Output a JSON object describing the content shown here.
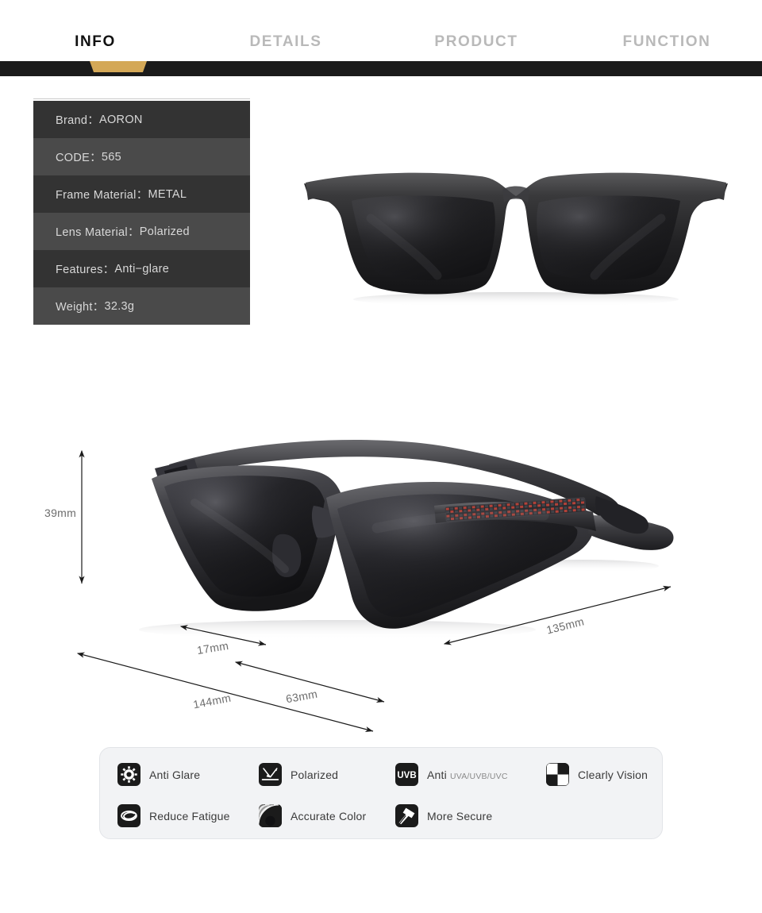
{
  "tabs": [
    {
      "label": "INFO",
      "active": true
    },
    {
      "label": "DETAILS",
      "active": false
    },
    {
      "label": "PRODUCT",
      "active": false
    },
    {
      "label": "FUNCTION",
      "active": false
    }
  ],
  "accent_color": "#d4a857",
  "spec_table": [
    {
      "label": "Brand：",
      "value": "AORON"
    },
    {
      "label": "CODE：",
      "value": "565"
    },
    {
      "label": "Frame Material：",
      "value": "METAL"
    },
    {
      "label": "Lens Material：",
      "value": "Polarized"
    },
    {
      "label": "Features：",
      "value": "Anti−glare"
    },
    {
      "label": "Weight：",
      "value": "32.3g"
    }
  ],
  "dimensions": {
    "height": "39mm",
    "bridge": "17mm",
    "lens_width": "63mm",
    "frame_width": "144mm",
    "temple_length": "135mm"
  },
  "features": [
    {
      "icon": "sun-glare-icon",
      "label": "Anti Glare",
      "sub": ""
    },
    {
      "icon": "polarized-ray-icon",
      "label": "Polarized",
      "sub": ""
    },
    {
      "icon": "uvb-badge-icon",
      "label": "Anti ",
      "sub": "UVA/UVB/UVC"
    },
    {
      "icon": "checkerboard-icon",
      "label": "Clearly Vision",
      "sub": ""
    },
    {
      "icon": "eye-swirl-icon",
      "label": "Reduce Fatigue",
      "sub": ""
    },
    {
      "icon": "color-arc-icon",
      "label": "Accurate Color",
      "sub": ""
    },
    {
      "icon": "hammer-icon",
      "label": "More Secure",
      "sub": ""
    }
  ],
  "product": {
    "front_view_alt": "black rectangular polarized sunglasses front view",
    "angled_view_alt": "black metal polarized sunglasses three-quarter view with red carbon fiber temple insert"
  }
}
